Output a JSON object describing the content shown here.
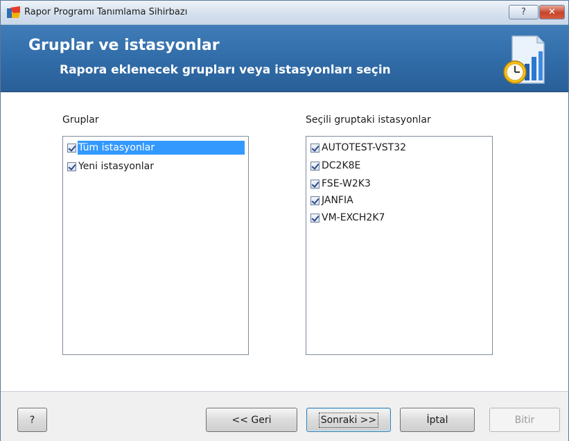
{
  "window": {
    "title": "Rapor Programı Tanımlama Sihirbazı",
    "help_label": "?",
    "close_label": "✕"
  },
  "header": {
    "title": "Gruplar ve istasyonlar",
    "subtitle": "Rapora eklenecek grupları veya istasyonları seçin"
  },
  "groups": {
    "label": "Gruplar",
    "items": [
      {
        "label": "Tüm istasyonlar",
        "checked": true,
        "selected": true
      },
      {
        "label": "Yeni istasyonlar",
        "checked": true,
        "selected": false
      }
    ]
  },
  "stations": {
    "label": "Seçili gruptaki istasyonlar",
    "items": [
      {
        "label": "AUTOTEST-VST32",
        "checked": true
      },
      {
        "label": "DC2K8E",
        "checked": true
      },
      {
        "label": "FSE-W2K3",
        "checked": true
      },
      {
        "label": "JANFIA",
        "checked": true
      },
      {
        "label": "VM-EXCH2K7",
        "checked": true
      }
    ]
  },
  "buttons": {
    "help": "?",
    "back": "<< Geri",
    "next": "Sonraki >>",
    "cancel": "İptal",
    "finish": "Bitir"
  },
  "icons": {
    "app": "avg-app-icon",
    "header": "report-schedule-icon"
  }
}
